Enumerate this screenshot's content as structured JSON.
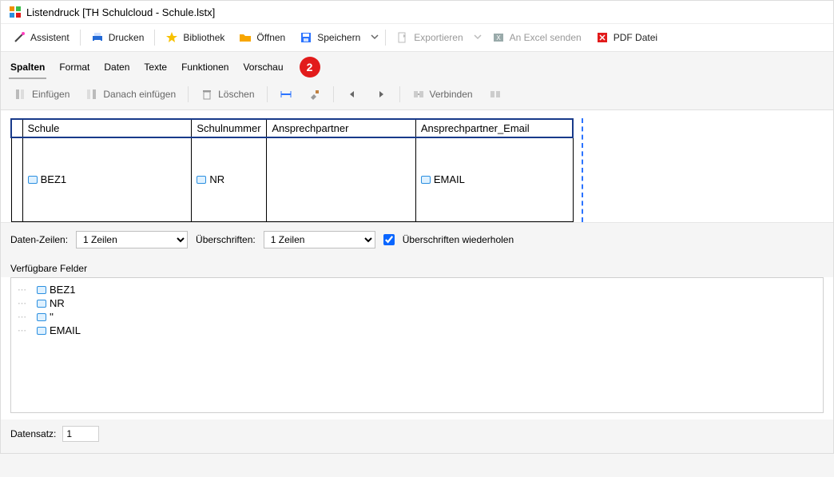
{
  "window": {
    "title": "Listendruck [TH Schulcloud - Schule.lstx]"
  },
  "main_toolbar": {
    "assistent": "Assistent",
    "drucken": "Drucken",
    "bibliothek": "Bibliothek",
    "oeffnen": "Öffnen",
    "speichern": "Speichern",
    "exportieren": "Exportieren",
    "excel": "An Excel senden",
    "pdf": "PDF Datei"
  },
  "tabs": {
    "spalten": "Spalten",
    "format": "Format",
    "daten": "Daten",
    "texte": "Texte",
    "funktionen": "Funktionen",
    "vorschau": "Vorschau"
  },
  "step_badge": "2",
  "subtool": {
    "einfuegen": "Einfügen",
    "danach": "Danach einfügen",
    "loeschen": "Löschen",
    "verbinden": "Verbinden"
  },
  "grid": {
    "headers": [
      "Schule",
      "Schulnummer",
      "Ansprechpartner",
      "Ansprechpartner_Email"
    ],
    "row0": [
      "BEZ1",
      "NR",
      "",
      "EMAIL"
    ]
  },
  "settings": {
    "daten_zeilen_label": "Daten-Zeilen:",
    "daten_zeilen_value": "1 Zeilen",
    "ueberschriften_label": "Überschriften:",
    "ueberschriften_value": "1 Zeilen",
    "repeat_label": "Überschriften wiederholen"
  },
  "avail_label": "Verfügbare Felder",
  "fields": [
    "BEZ1",
    "NR",
    "''",
    "EMAIL"
  ],
  "record": {
    "label": "Datensatz:",
    "value": "1"
  }
}
